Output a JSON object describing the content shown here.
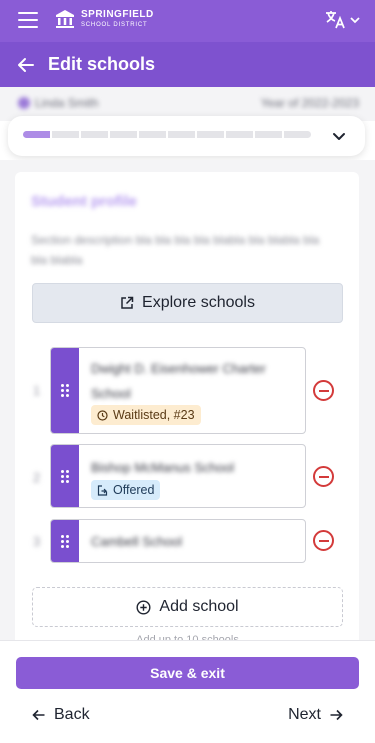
{
  "app": {
    "logo_line1": "SPRINGFIELD",
    "logo_line2": "SCHOOL DISTRICT",
    "brand_color": "#8a5cd6"
  },
  "header": {
    "title": "Edit schools"
  },
  "student": {
    "name": "Linda Smith",
    "year": "Year of 2022-2023"
  },
  "progress": {
    "total_steps": 10,
    "completed_steps": 1
  },
  "section": {
    "title": "Student profile",
    "description": "Section description bla bla bla bla blabla bla blabla bla bla blabla"
  },
  "explore_label": "Explore schools",
  "schools": [
    {
      "number": "1",
      "name": "Dwight D. Eisenhower Charter School",
      "badge": "Waitlisted, #23",
      "badge_type": "waitlisted"
    },
    {
      "number": "2",
      "name": "Bishop McManus School",
      "badge": "Offered",
      "badge_type": "offered"
    },
    {
      "number": "3",
      "name": "Cambell School",
      "badge": "",
      "badge_type": ""
    }
  ],
  "add_school_label": "Add school",
  "add_hint": "Add up to 10 schools",
  "footer": {
    "save_label": "Save & exit",
    "back_label": "Back",
    "next_label": "Next"
  },
  "icons": {
    "menu": "hamburger-icon",
    "translate": "translate-icon",
    "back": "arrow-left-icon",
    "expand": "chevron-down-icon",
    "external": "external-link-icon",
    "drag": "drag-handle-icon",
    "remove": "remove-circle-icon",
    "add": "plus-circle-icon",
    "clock": "clock-icon",
    "offered": "document-arrow-icon"
  }
}
